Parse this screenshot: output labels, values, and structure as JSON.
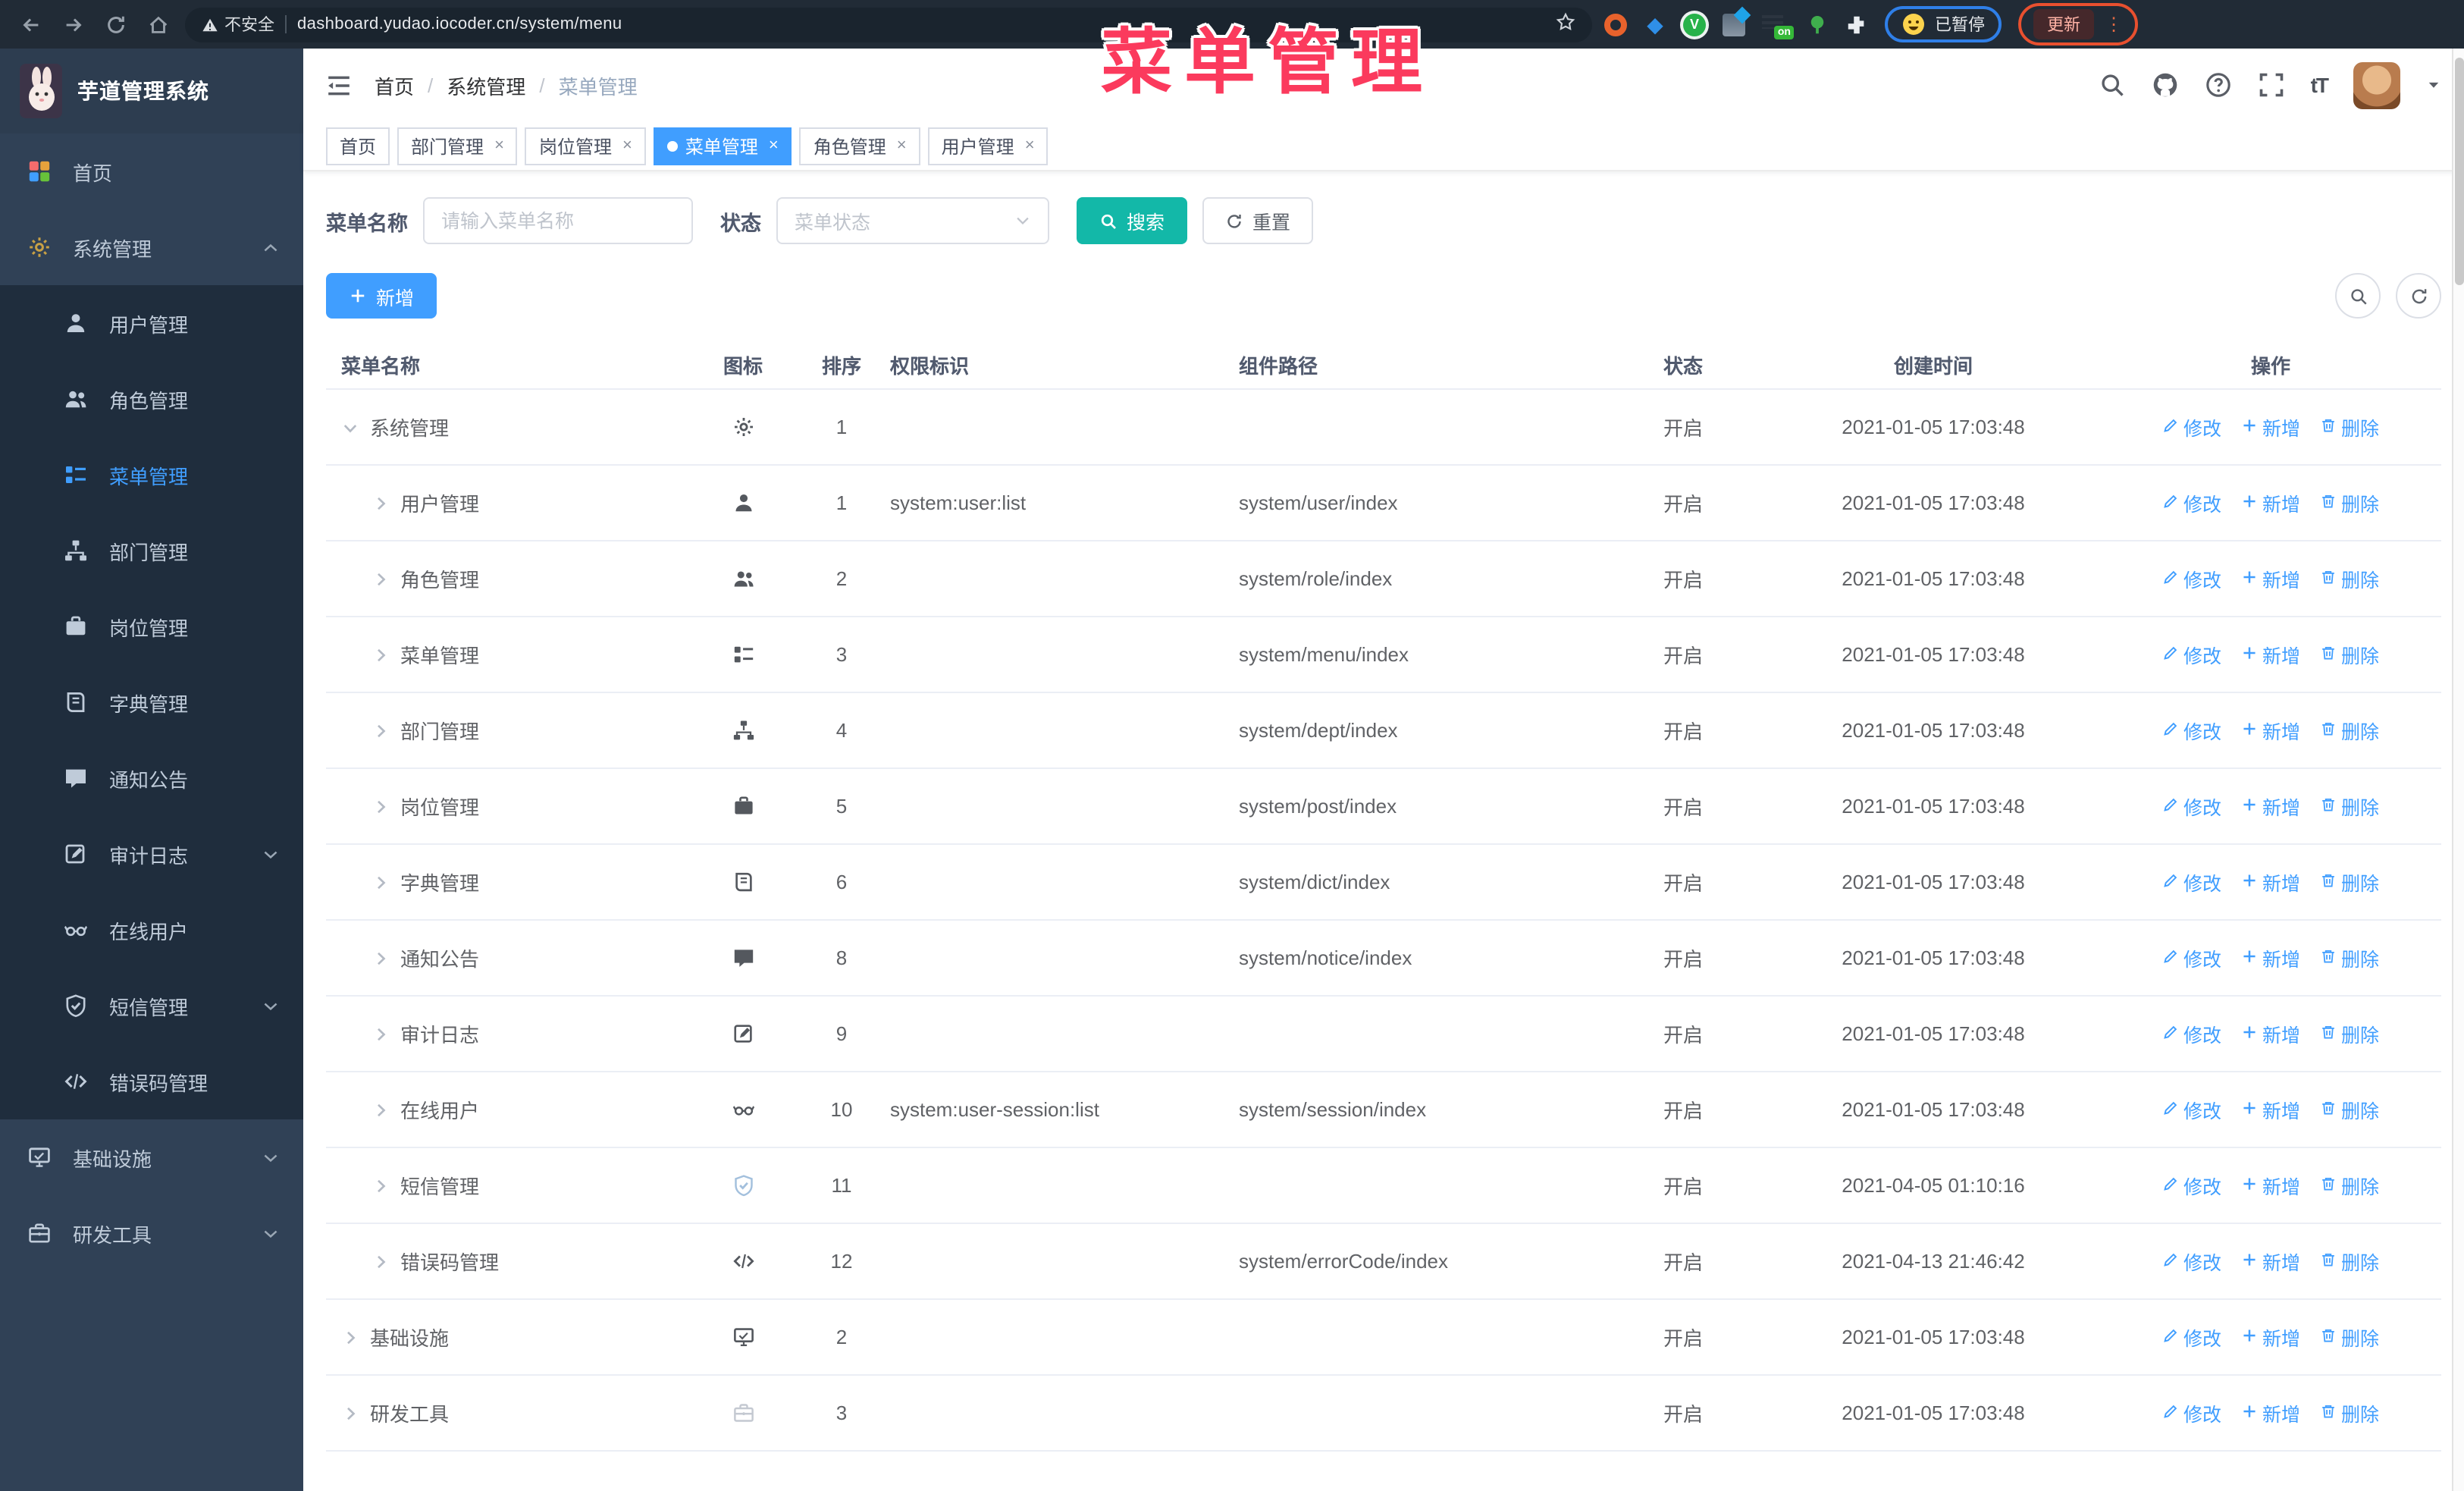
{
  "annotation": {
    "overlay_title": "菜单管理"
  },
  "colors": {
    "accent_blue": "#409eff",
    "accent_teal": "#13b8a8",
    "annotation_pink": "#fb3a5d",
    "sidebar_bg": "#304156",
    "submenu_bg": "#1f2d3d",
    "browser_bar_bg": "#212b36"
  },
  "browser": {
    "insecure_label": "不安全",
    "url": "dashboard.yudao.iocoder.cn/system/menu",
    "on_badge": "on",
    "paused_badge": "已暂停",
    "update_button": "更新"
  },
  "sidebar": {
    "app_title": "芋道管理系统",
    "items": [
      {
        "id": "home",
        "label": "首页",
        "icon": "home-dashboard-icon"
      },
      {
        "id": "system",
        "label": "系统管理",
        "icon": "gear-icon",
        "chevron": "up",
        "expanded": true,
        "children": [
          {
            "id": "user",
            "label": "用户管理",
            "icon": "user-icon"
          },
          {
            "id": "role",
            "label": "角色管理",
            "icon": "users-icon"
          },
          {
            "id": "menu",
            "label": "菜单管理",
            "icon": "menu-list-icon",
            "active": true
          },
          {
            "id": "dept",
            "label": "部门管理",
            "icon": "org-tree-icon"
          },
          {
            "id": "post",
            "label": "岗位管理",
            "icon": "post-icon"
          },
          {
            "id": "dict",
            "label": "字典管理",
            "icon": "dict-icon"
          },
          {
            "id": "notice",
            "label": "通知公告",
            "icon": "notice-icon"
          },
          {
            "id": "log",
            "label": "审计日志",
            "icon": "log-icon",
            "chevron": "down"
          },
          {
            "id": "online",
            "label": "在线用户",
            "icon": "online-icon"
          },
          {
            "id": "sms",
            "label": "短信管理",
            "icon": "sms-icon",
            "chevron": "down"
          },
          {
            "id": "errcode",
            "label": "错误码管理",
            "icon": "code-icon"
          }
        ]
      },
      {
        "id": "infra",
        "label": "基础设施",
        "icon": "infra-icon",
        "chevron": "down"
      },
      {
        "id": "tools",
        "label": "研发工具",
        "icon": "tools-icon",
        "chevron": "down"
      }
    ]
  },
  "navbar": {
    "breadcrumb": [
      "首页",
      "系统管理",
      "菜单管理"
    ],
    "separator": "/",
    "font_icon_label": "tT"
  },
  "tags": [
    {
      "label": "首页",
      "closable": false,
      "active": false
    },
    {
      "label": "部门管理",
      "closable": true,
      "active": false
    },
    {
      "label": "岗位管理",
      "closable": true,
      "active": false
    },
    {
      "label": "菜单管理",
      "closable": true,
      "active": true
    },
    {
      "label": "角色管理",
      "closable": true,
      "active": false
    },
    {
      "label": "用户管理",
      "closable": true,
      "active": false
    }
  ],
  "filters": {
    "name_label": "菜单名称",
    "name_placeholder": "请输入菜单名称",
    "status_label": "状态",
    "status_placeholder": "菜单状态",
    "search_label": "搜索",
    "reset_label": "重置"
  },
  "toolbar": {
    "add_label": "新增"
  },
  "table": {
    "headers": [
      "菜单名称",
      "图标",
      "排序",
      "权限标识",
      "组件路径",
      "状态",
      "创建时间",
      "操作"
    ],
    "ops": [
      "修改",
      "新增",
      "删除"
    ],
    "rows": [
      {
        "name": "系统管理",
        "level": 0,
        "caret": "down",
        "icon": "gear-icon",
        "sort": "1",
        "perm": "",
        "path": "",
        "status": "开启",
        "time": "2021-01-05 17:03:48"
      },
      {
        "name": "用户管理",
        "level": 1,
        "caret": "right",
        "icon": "user-icon",
        "sort": "1",
        "perm": "system:user:list",
        "path": "system/user/index",
        "status": "开启",
        "time": "2021-01-05 17:03:48"
      },
      {
        "name": "角色管理",
        "level": 1,
        "caret": "right",
        "icon": "users-icon",
        "sort": "2",
        "perm": "",
        "path": "system/role/index",
        "status": "开启",
        "time": "2021-01-05 17:03:48"
      },
      {
        "name": "菜单管理",
        "level": 1,
        "caret": "right",
        "icon": "menu-list-icon",
        "sort": "3",
        "perm": "",
        "path": "system/menu/index",
        "status": "开启",
        "time": "2021-01-05 17:03:48"
      },
      {
        "name": "部门管理",
        "level": 1,
        "caret": "right",
        "icon": "org-tree-icon",
        "sort": "4",
        "perm": "",
        "path": "system/dept/index",
        "status": "开启",
        "time": "2021-01-05 17:03:48"
      },
      {
        "name": "岗位管理",
        "level": 1,
        "caret": "right",
        "icon": "post-icon",
        "sort": "5",
        "perm": "",
        "path": "system/post/index",
        "status": "开启",
        "time": "2021-01-05 17:03:48"
      },
      {
        "name": "字典管理",
        "level": 1,
        "caret": "right",
        "icon": "dict-icon",
        "sort": "6",
        "perm": "",
        "path": "system/dict/index",
        "status": "开启",
        "time": "2021-01-05 17:03:48"
      },
      {
        "name": "通知公告",
        "level": 1,
        "caret": "right",
        "icon": "notice-icon",
        "sort": "8",
        "perm": "",
        "path": "system/notice/index",
        "status": "开启",
        "time": "2021-01-05 17:03:48"
      },
      {
        "name": "审计日志",
        "level": 1,
        "caret": "right",
        "icon": "log-icon",
        "sort": "9",
        "perm": "",
        "path": "",
        "status": "开启",
        "time": "2021-01-05 17:03:48"
      },
      {
        "name": "在线用户",
        "level": 1,
        "caret": "right",
        "icon": "online-icon",
        "sort": "10",
        "perm": "system:user-session:list",
        "path": "system/session/index",
        "status": "开启",
        "time": "2021-01-05 17:03:48"
      },
      {
        "name": "短信管理",
        "level": 1,
        "caret": "right",
        "icon": "sms-icon",
        "sort": "11",
        "perm": "",
        "path": "",
        "status": "开启",
        "time": "2021-04-05 01:10:16",
        "icon_class": "lite"
      },
      {
        "name": "错误码管理",
        "level": 1,
        "caret": "right",
        "icon": "code-icon",
        "sort": "12",
        "perm": "",
        "path": "system/errorCode/index",
        "status": "开启",
        "time": "2021-04-13 21:46:42"
      },
      {
        "name": "基础设施",
        "level": 0,
        "caret": "right",
        "icon": "infra-icon",
        "sort": "2",
        "perm": "",
        "path": "",
        "status": "开启",
        "time": "2021-01-05 17:03:48"
      },
      {
        "name": "研发工具",
        "level": 0,
        "caret": "right",
        "icon": "tools-icon",
        "sort": "3",
        "perm": "",
        "path": "",
        "status": "开启",
        "time": "2021-01-05 17:03:48",
        "icon_class": "pale"
      }
    ]
  }
}
